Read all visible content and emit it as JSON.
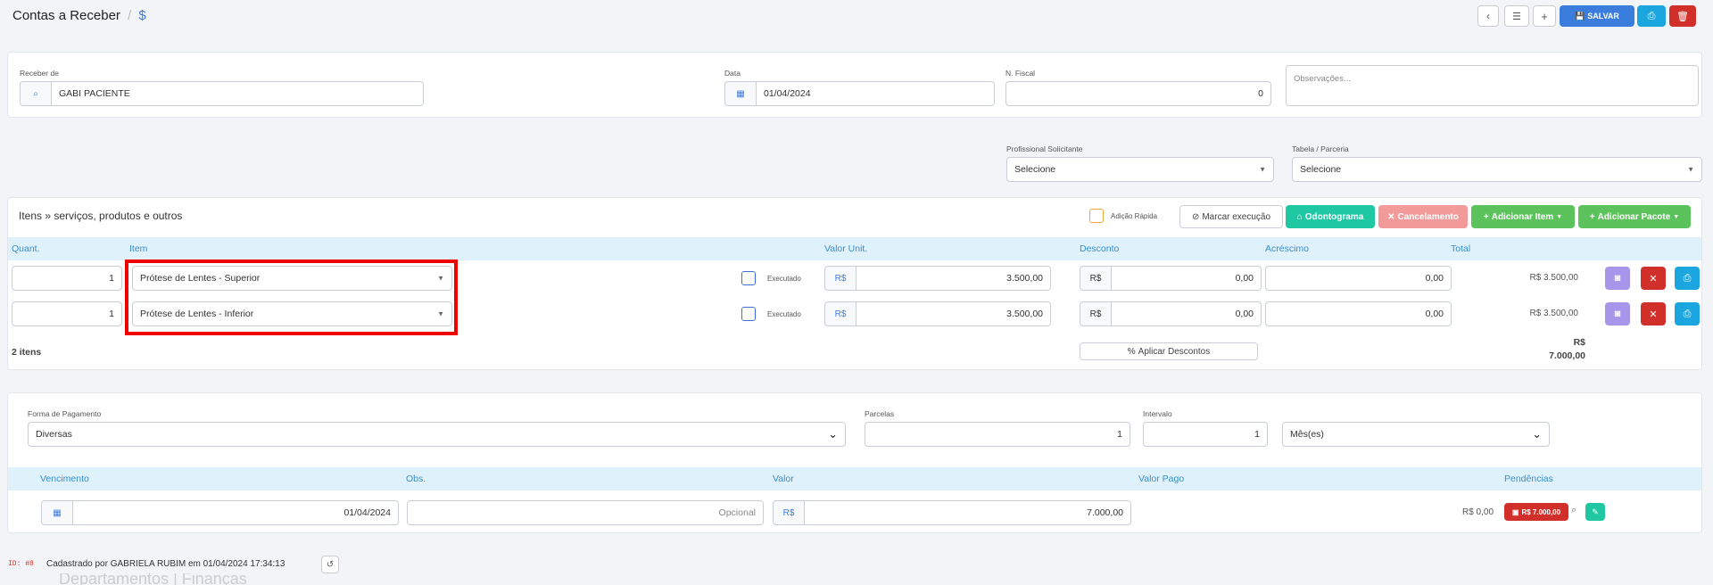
{
  "header": {
    "title": "Contas a Receber",
    "separator": "/",
    "dollar": "$",
    "save_label": "SALVAR"
  },
  "form": {
    "receber_de_label": "Receber de",
    "receber_de_value": "GABI PACIENTE",
    "data_label": "Data",
    "data_value": "01/04/2024",
    "nfiscal_label": "N. Fiscal",
    "nfiscal_value": "0",
    "obs_placeholder": "Observações...",
    "prof_label": "Profissional Solicitante",
    "prof_value": "Selecione",
    "tabela_label": "Tabela / Parceria",
    "tabela_value": "Selecione"
  },
  "items": {
    "title": "Itens » serviços, produtos e outros",
    "adicao_rapida": "Adição Rápida",
    "marcar_execucao": "Marcar execução",
    "odontograma": "Odontograma",
    "cancelamento": "Cancelamento",
    "adicionar_item": "Adicionar Item",
    "adicionar_pacote": "Adicionar Pacote",
    "columns": {
      "quant": "Quant.",
      "item": "Item",
      "valor_unit": "Valor Unit.",
      "desconto": "Desconto",
      "acrescimo": "Acréscimo",
      "total": "Total"
    },
    "currency": "R$",
    "executado": "Executado",
    "rows": [
      {
        "quant": "1",
        "item": "Prótese de Lentes - Superior",
        "valor": "3.500,00",
        "desconto": "0,00",
        "acrescimo": "0,00",
        "total": "R$ 3.500,00"
      },
      {
        "quant": "1",
        "item": "Prótese de Lentes - Inferior",
        "valor": "3.500,00",
        "desconto": "0,00",
        "acrescimo": "0,00",
        "total": "R$ 3.500,00"
      }
    ],
    "count": "2 itens",
    "aplicar_descontos": "Aplicar Descontos",
    "total_currency": "R$",
    "total_value": "7.000,00"
  },
  "payment": {
    "forma_label": "Forma de Pagamento",
    "forma_value": "Diversas",
    "parcelas_label": "Parcelas",
    "parcelas_value": "1",
    "intervalo_label": "Intervalo",
    "intervalo_value": "1",
    "unidade_value": "Mês(es)",
    "columns": {
      "vencimento": "Vencimento",
      "obs": "Obs.",
      "valor": "Valor",
      "valor_pago": "Valor Pago",
      "pendencias": "Pendências"
    },
    "row": {
      "vencimento": "01/04/2024",
      "obs_placeholder": "Opcional",
      "currency": "R$",
      "valor": "7.000,00",
      "valor_pago": "R$ 0,00",
      "pendencia": "R$ 7.000,00"
    }
  },
  "footer": {
    "id_label": "ID: #8",
    "cadastro": "Cadastrado por GABRIELA RUBIM em 01/04/2024 17:34:13",
    "faded": "Departamentos | Finanças"
  },
  "colors": {
    "accent": "#3b7ddd",
    "teal": "#1fc8a3",
    "red": "#d1302a",
    "green": "#5cc35c",
    "pink": "#f19a99",
    "purple": "#a795ea",
    "cyan": "#1ca6e0",
    "highlight": "#ee0000"
  }
}
